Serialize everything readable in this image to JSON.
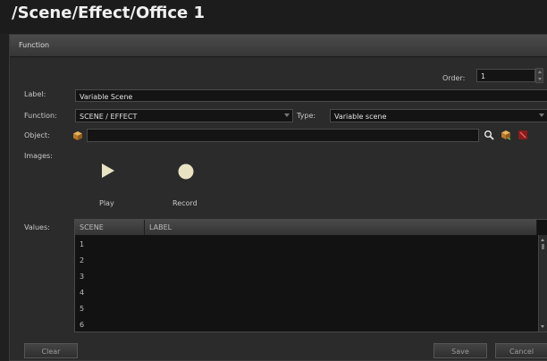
{
  "window": {
    "title": "/Scene/Effect/Office 1"
  },
  "panel": {
    "header": "Function"
  },
  "order": {
    "label": "Order:",
    "value": "1"
  },
  "label_field": {
    "label": "Label:",
    "value": "Variable Scene"
  },
  "function_field": {
    "label": "Function:",
    "value": "SCENE / EFFECT"
  },
  "type_field": {
    "label": "Type:",
    "value": "Variable scene"
  },
  "object_field": {
    "label": "Object:",
    "value": ""
  },
  "images": {
    "label": "Images:",
    "items": [
      {
        "label": "Play",
        "icon": "play-icon"
      },
      {
        "label": "Record",
        "icon": "record-icon"
      }
    ]
  },
  "values": {
    "label": "Values:",
    "columns": [
      "SCENE",
      "LABEL"
    ],
    "rows": [
      "1",
      "2",
      "3",
      "4",
      "5",
      "6"
    ]
  },
  "buttons": {
    "clear": "Clear",
    "save": "Save",
    "cancel": "Cancel"
  },
  "colors": {
    "background": "#202020",
    "panel": "#2b2b2b",
    "field": "#141414",
    "record": "#e9e3c4"
  }
}
